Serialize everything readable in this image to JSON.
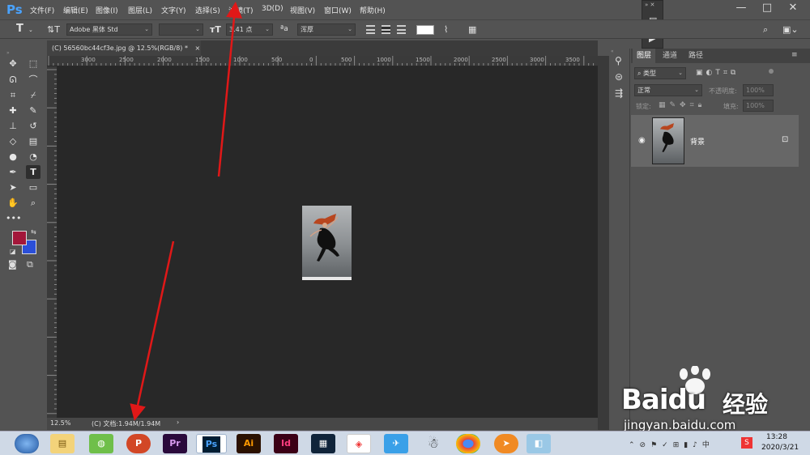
{
  "app": {
    "logo": "Ps"
  },
  "menu": [
    "文件(F)",
    "编辑(E)",
    "图像(I)",
    "图层(L)",
    "文字(Y)",
    "选择(S)",
    "滤镜(T)",
    "3D(D)",
    "视图(V)",
    "窗口(W)",
    "帮助(H)"
  ],
  "window_controls": {
    "minimize": "—",
    "maximize": "□",
    "close": "✕"
  },
  "options": {
    "font_family": "Adobe 黑体 Std",
    "font_style": "",
    "font_size": "3.41 点",
    "aa_label": "ªa",
    "antialias": "浑厚"
  },
  "document": {
    "tab_title": "(C) 56560bc44cf3e.jpg @ 12.5%(RGB/8) *",
    "tab_close": "×",
    "ruler_top": [
      "3000",
      "2500",
      "2000",
      "1500",
      "1000",
      "500",
      "0",
      "500",
      "1000",
      "1500",
      "2000",
      "2500",
      "3000",
      "3500"
    ],
    "zoom": "12.5%",
    "doc_info": "(C) 文档:1.94M/1.94M",
    "status_arrow": "›"
  },
  "layers_panel": {
    "tabs": [
      "图层",
      "通道",
      "路径"
    ],
    "filter_placeholder": "类型",
    "blend_mode": "正常",
    "opacity_label": "不透明度:",
    "opacity_value": "100%",
    "lock_label": "锁定:",
    "fill_label": "填充:",
    "fill_value": "100%",
    "layer_name": "背景"
  },
  "taskbar": {
    "apps": [
      "Pr",
      "Ps",
      "Ai",
      "Id"
    ],
    "time": "13:28",
    "date": "2020/3/21"
  },
  "watermark": {
    "brand": "Baidu",
    "cn": "经验",
    "url": "jingyan.baidu.com"
  },
  "colors": {
    "foreground": "#a3173a",
    "background": "#2b4fd8",
    "ps_blue": "#4aa3ff",
    "annotation_arrow": "#e01818"
  }
}
